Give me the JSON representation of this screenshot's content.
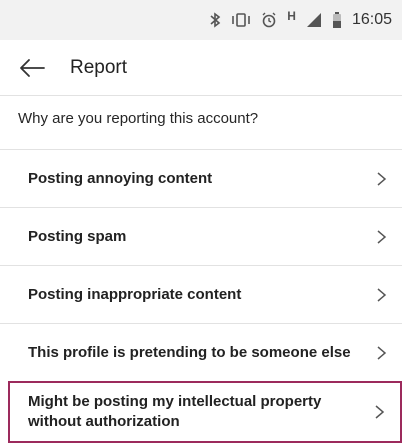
{
  "status_bar": {
    "time": "16:05",
    "h_label": "H",
    "icons": [
      "bluetooth-icon",
      "vibrate-icon",
      "alarm-icon",
      "signal-icon",
      "battery-icon"
    ]
  },
  "header": {
    "title": "Report",
    "back_icon": "arrow-left-icon"
  },
  "question": "Why are you reporting this account?",
  "options": [
    {
      "label": "Posting annoying content"
    },
    {
      "label": "Posting spam"
    },
    {
      "label": "Posting inappropriate content"
    },
    {
      "label": "This profile is pretending to be someone else"
    },
    {
      "label": "Might be posting my intellectual property without authorization"
    }
  ],
  "colors": {
    "highlight_border": "#9c2a5c",
    "status_bg": "#f2f2f2"
  }
}
